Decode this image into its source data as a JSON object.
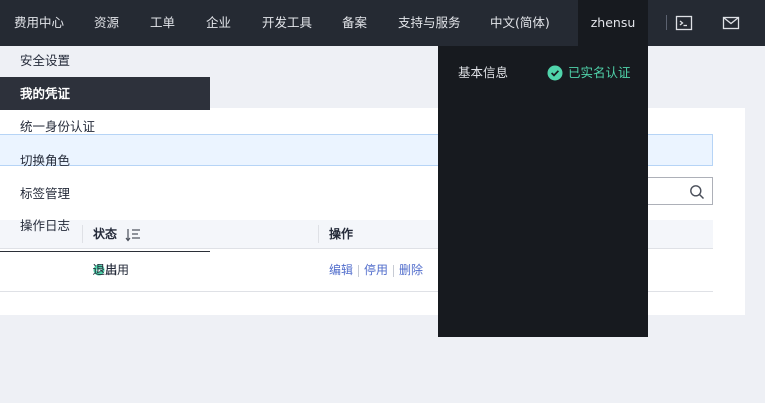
{
  "topnav": {
    "items": [
      "费用中心",
      "资源",
      "工单",
      "企业",
      "开发工具",
      "备案",
      "支持与服务",
      "中文(简体)"
    ],
    "user": "zhensu",
    "icons": [
      "terminal-icon",
      "mail-icon"
    ]
  },
  "table": {
    "headers": {
      "status": "状态",
      "actions": "操作"
    },
    "rows": [
      {
        "status": "启用",
        "actions": [
          "编辑",
          "停用",
          "删除"
        ]
      }
    ]
  },
  "account_menu": {
    "items": [
      "基本信息",
      "安全设置",
      "我的凭证",
      "统一身份认证",
      "切换角色",
      "标签管理",
      "操作日志"
    ],
    "active_item": "我的凭证",
    "verified_badge": "已实名认证",
    "logout": "退出"
  },
  "colors": {
    "topbar": "#252a33",
    "dropdown": "#171a1f",
    "verified": "#50d4ab",
    "link": "#526ecc",
    "status_enabled": "#50d4ab"
  }
}
